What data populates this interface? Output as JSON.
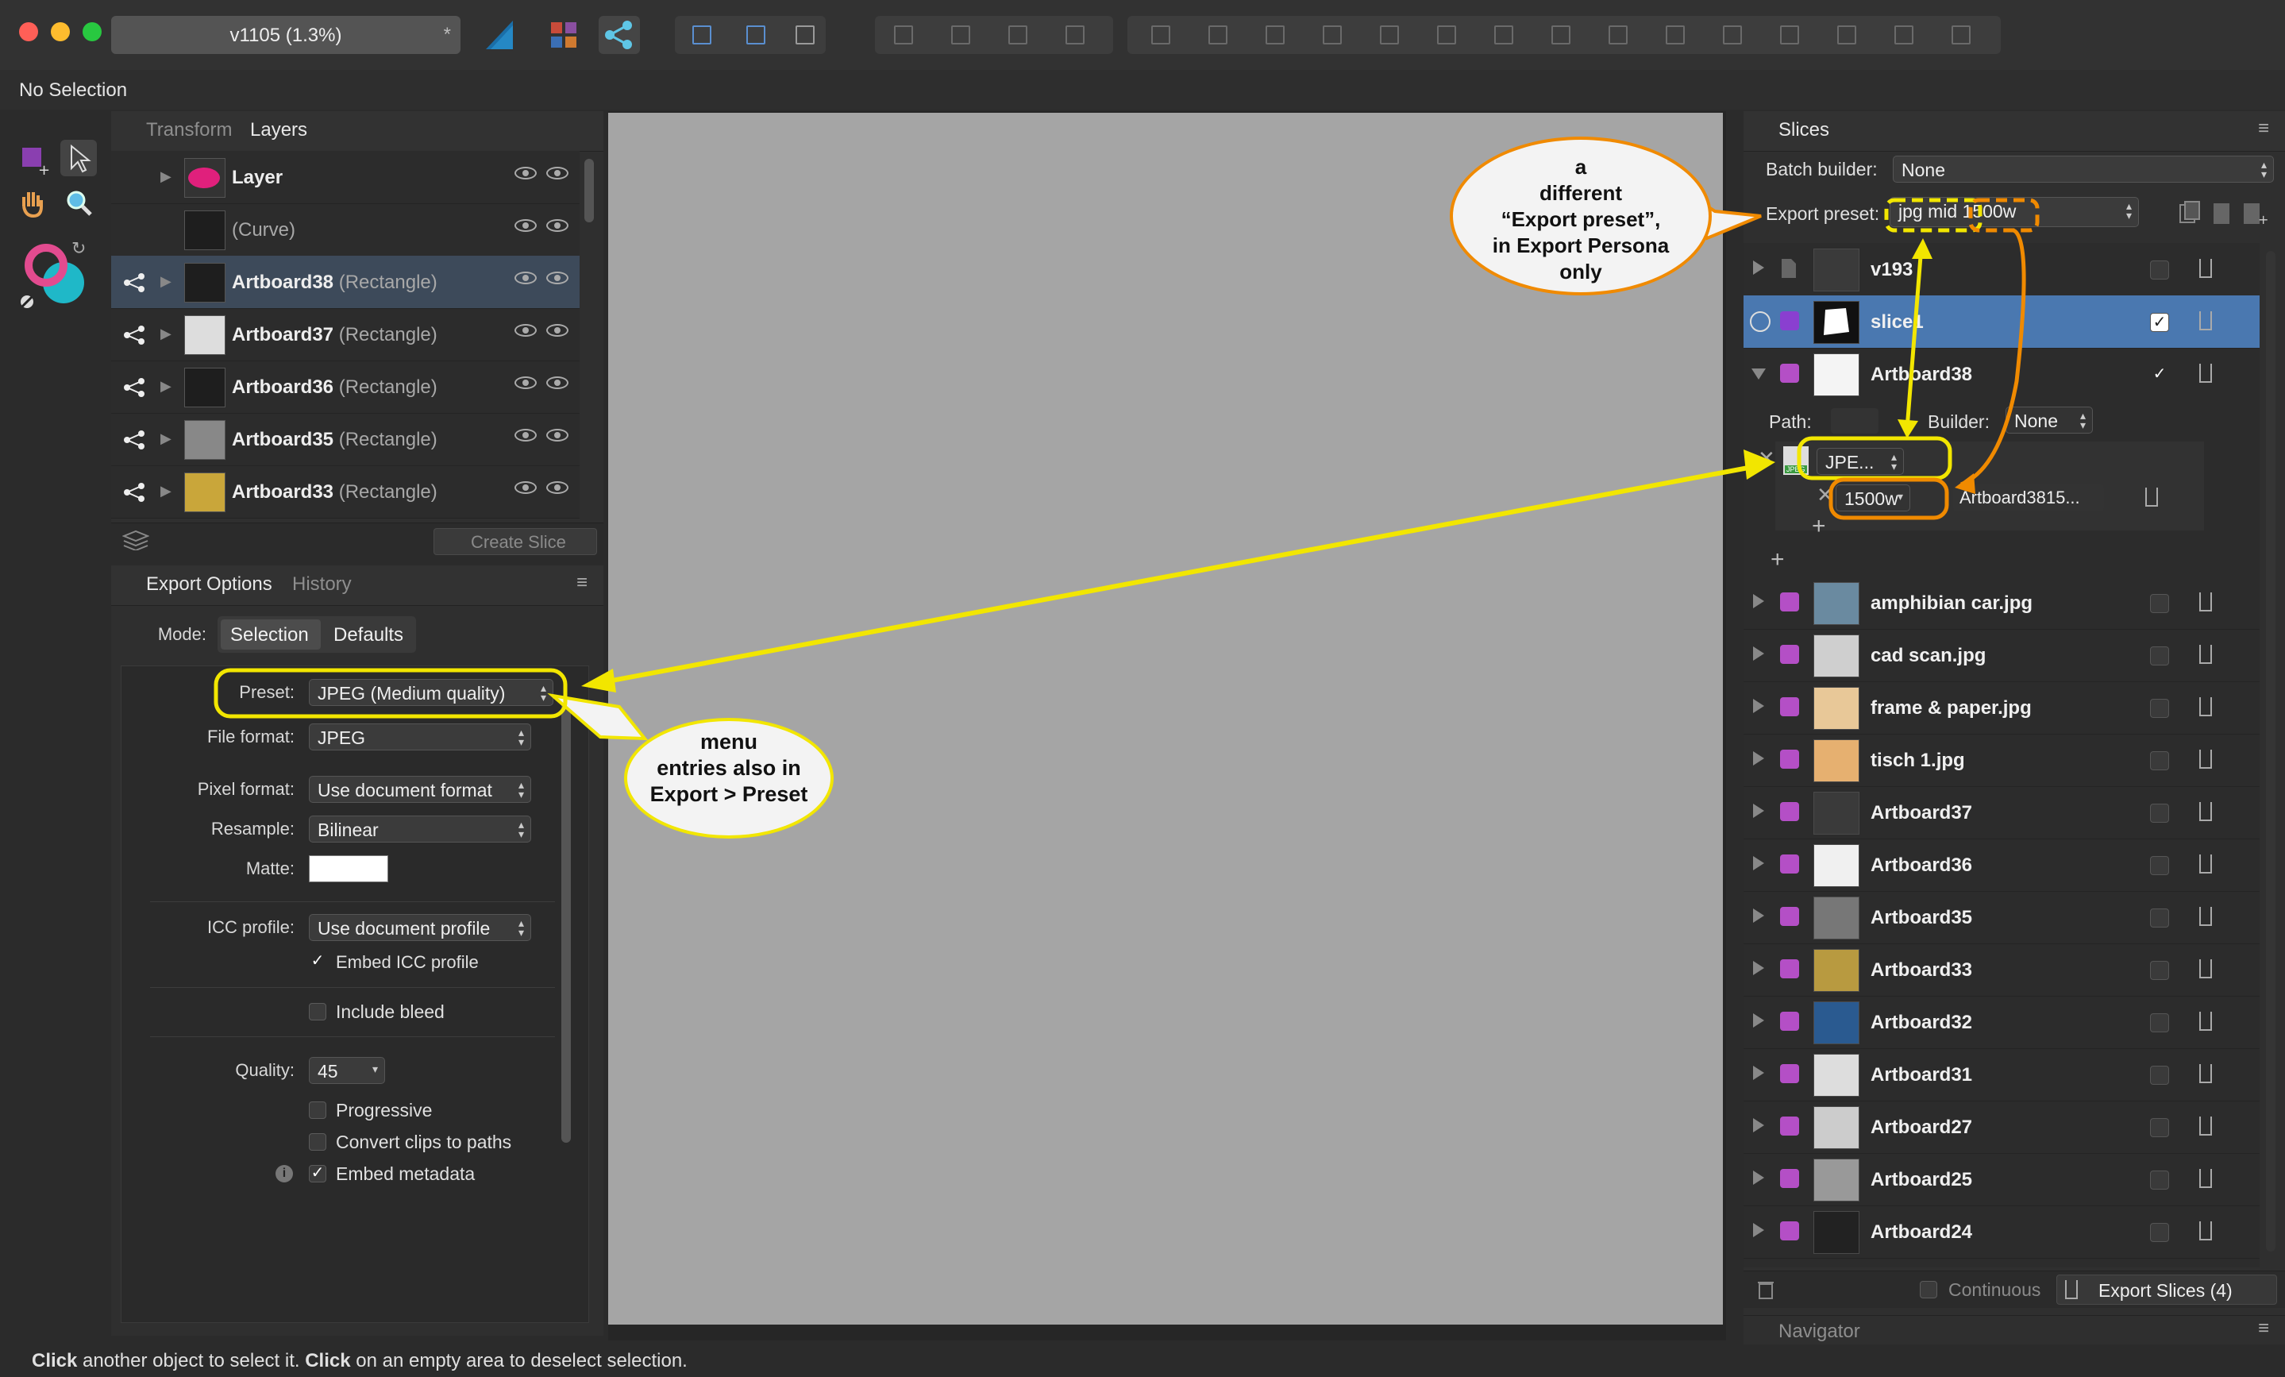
{
  "window": {
    "doc_tab_title": "v1105  (1.3%)",
    "doc_tab_modified": "*",
    "traffic_colors": [
      "#ff5f57",
      "#febc2e",
      "#28c840"
    ]
  },
  "context": {
    "selection_status": "No Selection"
  },
  "layers_panel": {
    "tabs": [
      "Transform",
      "Layers"
    ],
    "active_tab": "Layers",
    "rows": [
      {
        "name": "Layer",
        "type": "",
        "share": false
      },
      {
        "name": "(Curve)",
        "type": "",
        "share": false
      },
      {
        "name": "Artboard38",
        "type": "(Rectangle)",
        "share": true
      },
      {
        "name": "Artboard37",
        "type": "(Rectangle)",
        "share": true
      },
      {
        "name": "Artboard36",
        "type": "(Rectangle)",
        "share": true
      },
      {
        "name": "Artboard35",
        "type": "(Rectangle)",
        "share": true
      },
      {
        "name": "Artboard33",
        "type": "(Rectangle)",
        "share": true
      }
    ],
    "create_slice_label": "Create Slice"
  },
  "export_options": {
    "tabs": [
      "Export Options",
      "History"
    ],
    "mode_label": "Mode:",
    "mode_options": [
      "Selection",
      "Defaults"
    ],
    "preset_label": "Preset:",
    "preset_value": "JPEG (Medium quality)",
    "file_format_label": "File format:",
    "file_format_value": "JPEG",
    "pixel_format_label": "Pixel format:",
    "pixel_format_value": "Use document format",
    "resample_label": "Resample:",
    "resample_value": "Bilinear",
    "matte_label": "Matte:",
    "icc_label": "ICC profile:",
    "icc_value": "Use document profile",
    "embed_icc_label": "Embed ICC profile",
    "include_bleed_label": "Include bleed",
    "quality_label": "Quality:",
    "quality_value": "45",
    "progressive_label": "Progressive",
    "convert_clips_label": "Convert clips to paths",
    "embed_metadata_label": "Embed metadata"
  },
  "slices_panel": {
    "title": "Slices",
    "batch_builder_label": "Batch builder:",
    "batch_builder_value": "None",
    "export_preset_label": "Export preset:",
    "export_preset_value": "jpg mid 1500w",
    "rows_top": [
      {
        "name": "v193",
        "checked": false
      },
      {
        "name": "slice1",
        "checked": true,
        "selected": true
      },
      {
        "name": "Artboard38",
        "checked": true,
        "expanded": true
      }
    ],
    "path_label": "Path:",
    "builder_label": "Builder:",
    "builder_value": "None",
    "format_value": "JPE...",
    "size_value": "1500w",
    "filename_value": "Artboard3815...",
    "rows_bottom": [
      "amphibian car.jpg",
      "cad scan.jpg",
      "frame & paper.jpg",
      "tisch 1.jpg",
      "Artboard37",
      "Artboard36",
      "Artboard35",
      "Artboard33",
      "Artboard32",
      "Artboard31",
      "Artboard27",
      "Artboard25",
      "Artboard24"
    ],
    "continuous_label": "Continuous",
    "export_slices_label": "Export Slices (4)",
    "navigator_label": "Navigator"
  },
  "annotations": {
    "bubble_top": [
      "a",
      "different",
      "“Export preset”,",
      "in Export Persona",
      "only"
    ],
    "bubble_left": [
      "menu",
      "entries also in",
      "Export > Preset"
    ],
    "yellow": "#f2e600",
    "orange": "#f08a00"
  },
  "status": {
    "part1_bold": "Click",
    "part2": " another object to select it. ",
    "part3_bold": "Click",
    "part4": " on an empty area to deselect selection."
  }
}
